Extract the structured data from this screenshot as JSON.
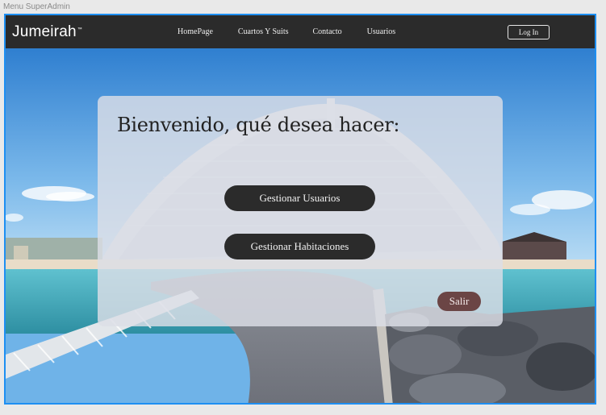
{
  "frame": {
    "label": "Menu SuperAdmin"
  },
  "navbar": {
    "brand": "Jumeirah",
    "brand_mark": "™",
    "links": [
      "HomePage",
      "Cuartos Y Suits",
      "Contacto",
      "Usuarios"
    ],
    "login_label": "Log In"
  },
  "card": {
    "title": "Bienvenido, qué desea hacer:",
    "manage_users_label": "Gestionar Usuarios",
    "manage_rooms_label": "Gestionar Habitaciones",
    "exit_label": "Salir"
  },
  "colors": {
    "navbar_bg": "#2b2b2b",
    "button_dark": "#2b2b2b",
    "exit_button": "#6b4545",
    "frame_border": "#1e8ff2"
  }
}
